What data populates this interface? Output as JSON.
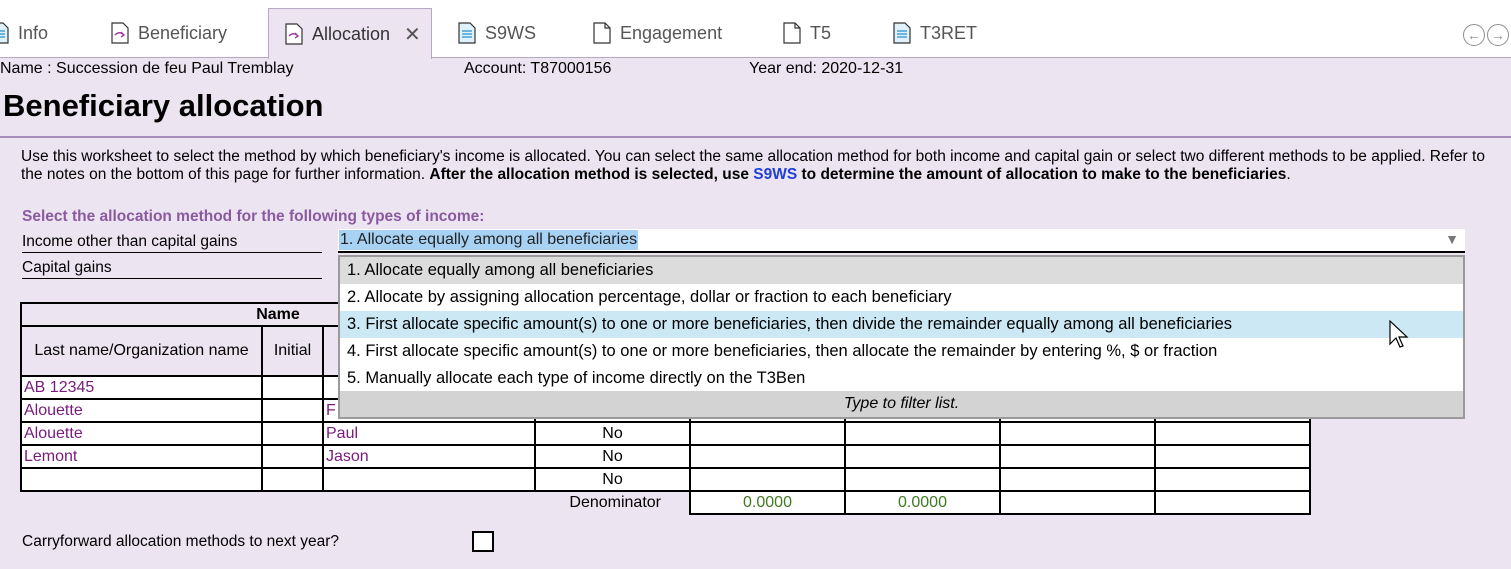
{
  "tabs": [
    {
      "label": "Info",
      "icon": "document-lines-icon"
    },
    {
      "label": "Beneficiary",
      "icon": "document-arrow-icon"
    },
    {
      "label": "Allocation",
      "icon": "document-arrow-icon",
      "active": true,
      "close": "✕"
    },
    {
      "label": "S9WS",
      "icon": "document-lines-icon"
    },
    {
      "label": "Engagement",
      "icon": "blank-document-icon"
    },
    {
      "label": "T5",
      "icon": "blank-document-icon"
    },
    {
      "label": "T3RET",
      "icon": "document-lines-icon"
    }
  ],
  "nav": {
    "back": "←",
    "forward": "→"
  },
  "header": {
    "name": "Name : Succession de feu Paul Tremblay",
    "account": "Account: T87000156",
    "year_end": "Year end: 2020-12-31",
    "title": "Beneficiary allocation"
  },
  "intro": {
    "text": "Use this worksheet to select the method by which beneficiary's income is allocated. You can select the same allocation method for both income and capital gain or select two different methods to be applied. Refer to the notes on the bottom of this page for further information. ",
    "bold_before": "After the allocation method is selected, use ",
    "link": "S9WS",
    "bold_after": " to determine the amount of allocation to make to the beneficiaries",
    "end": "."
  },
  "methods": {
    "section_label": "Select the allocation method for the following types of income:",
    "income_label": "Income other than capital gains",
    "capital_label": "Capital gains",
    "selected_value": "1. Allocate equally among all beneficiaries",
    "arrow": "▼"
  },
  "dropdown": {
    "options": [
      "1. Allocate equally among all beneficiaries",
      "2. Allocate by assigning allocation percentage, dollar or fraction to each beneficiary",
      "3. First allocate specific amount(s) to one or more beneficiaries, then divide the remainder equally among all beneficiaries",
      "4. First allocate specific amount(s) to one or more beneficiaries, then allocate the remainder by entering %, $ or fraction",
      "5. Manually allocate each type of income directly on the T3Ben"
    ],
    "selected_index": 0,
    "hover_index": 2,
    "filter_hint": "Type to filter list."
  },
  "table": {
    "group_header": "Name",
    "col_last": "Last name/Organization name",
    "col_initial": "Initial",
    "rows": [
      {
        "last": "AB 12345",
        "initial": "",
        "first": "",
        "flag": ""
      },
      {
        "last": "Alouette",
        "initial": "",
        "first": "F",
        "flag": ""
      },
      {
        "last": "Alouette",
        "initial": "",
        "first": "Paul",
        "flag": "No"
      },
      {
        "last": "Lemont",
        "initial": "",
        "first": "Jason",
        "flag": "No"
      },
      {
        "last": "",
        "initial": "",
        "first": "",
        "flag": "No"
      }
    ],
    "denominator_label": "Denominator",
    "denominator_values": [
      "0.0000",
      "0.0000"
    ]
  },
  "carryforward": {
    "label": "Carryforward allocation methods to next year?"
  },
  "colors": {
    "accent_purple": "#7a1a7d",
    "link_blue": "#1f3fd6",
    "hover": "#cce8f4",
    "background": "#ece4f1"
  }
}
